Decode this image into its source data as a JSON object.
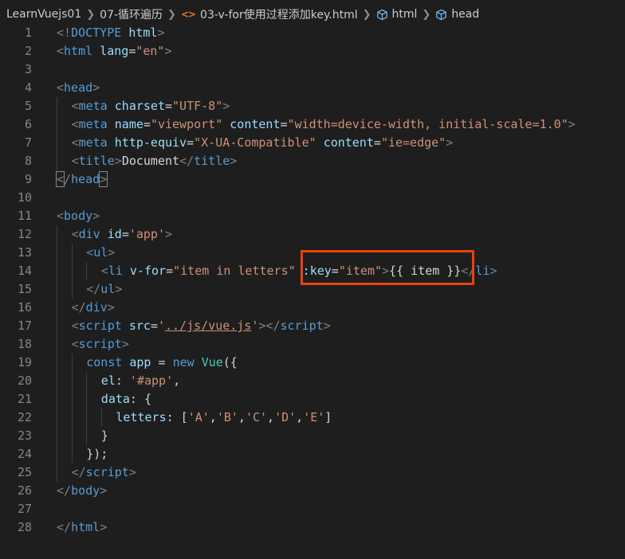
{
  "breadcrumb": {
    "folder1": "LearnVuejs01",
    "folder2": "07-循环遍历",
    "file_icon": "<>",
    "file": "03-v-for使用过程添加key.html",
    "element1": "html",
    "element2": "head"
  },
  "highlight": {
    "color": "#e8410f"
  },
  "lines": [
    {
      "n": "1",
      "indent": 0,
      "tokens": [
        [
          "p",
          "<!"
        ],
        [
          "tag",
          "DOCTYPE"
        ],
        [
          "txt",
          " "
        ],
        [
          "attr",
          "html"
        ],
        [
          "p",
          ">"
        ]
      ]
    },
    {
      "n": "2",
      "indent": 0,
      "tokens": [
        [
          "p",
          "<"
        ],
        [
          "tag",
          "html"
        ],
        [
          "txt",
          " "
        ],
        [
          "attr",
          "lang"
        ],
        [
          "txt",
          "="
        ],
        [
          "str",
          "\"en\""
        ],
        [
          "p",
          ">"
        ]
      ]
    },
    {
      "n": "3",
      "indent": 0,
      "tokens": []
    },
    {
      "n": "4",
      "indent": 0,
      "tokens": [
        [
          "p",
          "<"
        ],
        [
          "tag",
          "head"
        ],
        [
          "p",
          ">"
        ]
      ]
    },
    {
      "n": "5",
      "indent": 1,
      "tokens": [
        [
          "p",
          "<"
        ],
        [
          "tag",
          "meta"
        ],
        [
          "txt",
          " "
        ],
        [
          "attr",
          "charset"
        ],
        [
          "txt",
          "="
        ],
        [
          "str",
          "\"UTF-8\""
        ],
        [
          "p",
          ">"
        ]
      ]
    },
    {
      "n": "6",
      "indent": 1,
      "tokens": [
        [
          "p",
          "<"
        ],
        [
          "tag",
          "meta"
        ],
        [
          "txt",
          " "
        ],
        [
          "attr",
          "name"
        ],
        [
          "txt",
          "="
        ],
        [
          "str",
          "\"viewport\""
        ],
        [
          "txt",
          " "
        ],
        [
          "attr",
          "content"
        ],
        [
          "txt",
          "="
        ],
        [
          "str",
          "\"width=device-width, initial-scale=1.0\""
        ],
        [
          "p",
          ">"
        ]
      ]
    },
    {
      "n": "7",
      "indent": 1,
      "tokens": [
        [
          "p",
          "<"
        ],
        [
          "tag",
          "meta"
        ],
        [
          "txt",
          " "
        ],
        [
          "attr",
          "http-equiv"
        ],
        [
          "txt",
          "="
        ],
        [
          "str",
          "\"X-UA-Compatible\""
        ],
        [
          "txt",
          " "
        ],
        [
          "attr",
          "content"
        ],
        [
          "txt",
          "="
        ],
        [
          "str",
          "\"ie=edge\""
        ],
        [
          "p",
          ">"
        ]
      ]
    },
    {
      "n": "8",
      "indent": 1,
      "tokens": [
        [
          "p",
          "<"
        ],
        [
          "tag",
          "title"
        ],
        [
          "p",
          ">"
        ],
        [
          "txt",
          "Document"
        ],
        [
          "p",
          "</"
        ],
        [
          "tag",
          "title"
        ],
        [
          "p",
          ">"
        ]
      ]
    },
    {
      "n": "9",
      "indent": 0,
      "tokens": [
        [
          "pb",
          "<"
        ],
        [
          "p",
          "/"
        ],
        [
          "tag",
          "head"
        ],
        [
          "pb",
          ">"
        ]
      ]
    },
    {
      "n": "10",
      "indent": 0,
      "tokens": []
    },
    {
      "n": "11",
      "indent": 0,
      "tokens": [
        [
          "p",
          "<"
        ],
        [
          "tag",
          "body"
        ],
        [
          "p",
          ">"
        ]
      ]
    },
    {
      "n": "12",
      "indent": 1,
      "tokens": [
        [
          "p",
          "<"
        ],
        [
          "tag",
          "div"
        ],
        [
          "txt",
          " "
        ],
        [
          "attr",
          "id"
        ],
        [
          "txt",
          "="
        ],
        [
          "str",
          "'app'"
        ],
        [
          "p",
          ">"
        ]
      ]
    },
    {
      "n": "13",
      "indent": 2,
      "tokens": [
        [
          "p",
          "<"
        ],
        [
          "tag",
          "ul"
        ],
        [
          "p",
          ">"
        ]
      ]
    },
    {
      "n": "14",
      "indent": 3,
      "tokens": [
        [
          "p",
          "<"
        ],
        [
          "tag",
          "li"
        ],
        [
          "txt",
          " "
        ],
        [
          "attr",
          "v-for"
        ],
        [
          "txt",
          "="
        ],
        [
          "str",
          "\"item in letters\""
        ],
        [
          "txt",
          " "
        ],
        [
          "attr",
          ":key"
        ],
        [
          "txt",
          "="
        ],
        [
          "str",
          "\"item\""
        ],
        [
          "p",
          ">"
        ],
        [
          "txt",
          "{{ item }}"
        ],
        [
          "p",
          "</"
        ],
        [
          "tag",
          "li"
        ],
        [
          "p",
          ">"
        ]
      ]
    },
    {
      "n": "15",
      "indent": 2,
      "tokens": [
        [
          "p",
          "</"
        ],
        [
          "tag",
          "ul"
        ],
        [
          "p",
          ">"
        ]
      ]
    },
    {
      "n": "16",
      "indent": 1,
      "tokens": [
        [
          "p",
          "</"
        ],
        [
          "tag",
          "div"
        ],
        [
          "p",
          ">"
        ]
      ]
    },
    {
      "n": "17",
      "indent": 1,
      "tokens": [
        [
          "p",
          "<"
        ],
        [
          "tag",
          "script"
        ],
        [
          "txt",
          " "
        ],
        [
          "attr",
          "src"
        ],
        [
          "txt",
          "="
        ],
        [
          "str",
          "'"
        ],
        [
          "strl",
          "../js/vue.js"
        ],
        [
          "str",
          "'"
        ],
        [
          "p",
          "></"
        ],
        [
          "tag",
          "script"
        ],
        [
          "p",
          ">"
        ]
      ]
    },
    {
      "n": "18",
      "indent": 1,
      "tokens": [
        [
          "p",
          "<"
        ],
        [
          "tag",
          "script"
        ],
        [
          "p",
          ">"
        ]
      ]
    },
    {
      "n": "19",
      "indent": 2,
      "tokens": [
        [
          "kw",
          "const"
        ],
        [
          "txt",
          " "
        ],
        [
          "var",
          "app"
        ],
        [
          "txt",
          " = "
        ],
        [
          "kw",
          "new"
        ],
        [
          "txt",
          " "
        ],
        [
          "cls",
          "Vue"
        ],
        [
          "txt",
          "({"
        ]
      ]
    },
    {
      "n": "20",
      "indent": 3,
      "tokens": [
        [
          "var",
          "el"
        ],
        [
          "txt",
          ": "
        ],
        [
          "str",
          "'#app'"
        ],
        [
          "txt",
          ","
        ]
      ]
    },
    {
      "n": "21",
      "indent": 3,
      "tokens": [
        [
          "var",
          "data"
        ],
        [
          "txt",
          ": {"
        ]
      ]
    },
    {
      "n": "22",
      "indent": 4,
      "tokens": [
        [
          "var",
          "letters"
        ],
        [
          "txt",
          ": ["
        ],
        [
          "str",
          "'A'"
        ],
        [
          "txt",
          ","
        ],
        [
          "str",
          "'B'"
        ],
        [
          "txt",
          ","
        ],
        [
          "str",
          "'C'"
        ],
        [
          "txt",
          ","
        ],
        [
          "str",
          "'D'"
        ],
        [
          "txt",
          ","
        ],
        [
          "str",
          "'E'"
        ],
        [
          "txt",
          "]"
        ]
      ]
    },
    {
      "n": "23",
      "indent": 3,
      "tokens": [
        [
          "txt",
          "}"
        ]
      ]
    },
    {
      "n": "24",
      "indent": 2,
      "tokens": [
        [
          "txt",
          "});"
        ]
      ]
    },
    {
      "n": "25",
      "indent": 1,
      "tokens": [
        [
          "p",
          "</"
        ],
        [
          "tag",
          "script"
        ],
        [
          "p",
          ">"
        ]
      ]
    },
    {
      "n": "26",
      "indent": 0,
      "tokens": [
        [
          "p",
          "</"
        ],
        [
          "tag",
          "body"
        ],
        [
          "p",
          ">"
        ]
      ]
    },
    {
      "n": "27",
      "indent": 0,
      "tokens": []
    },
    {
      "n": "28",
      "indent": 0,
      "tokens": [
        [
          "p",
          "</"
        ],
        [
          "tag",
          "html"
        ],
        [
          "p",
          ">"
        ]
      ]
    }
  ]
}
